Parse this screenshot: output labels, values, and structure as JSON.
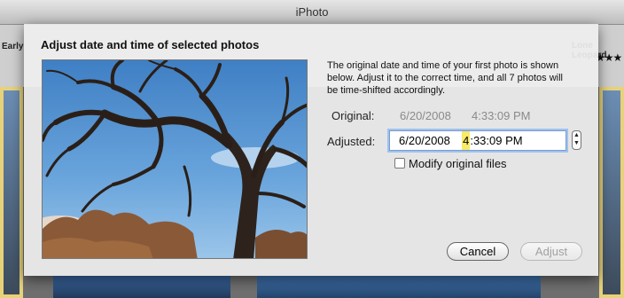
{
  "window": {
    "title": "iPhoto",
    "bg_labels": [
      "Early",
      "Lone Leopard"
    ],
    "bg_stars": "★★★"
  },
  "dialog": {
    "title": "Adjust date and time of selected photos",
    "description": "The original date and time of your first photo is shown below. Adjust it to the correct time, and all 7 photos will be time-shifted accordingly.",
    "original_label": "Original:",
    "original_date": "6/20/2008",
    "original_time": "4:33:09 PM",
    "adjusted_label": "Adjusted:",
    "adjusted_date": "6/20/2008",
    "adjusted_hour": "4",
    "adjusted_rest": ":33:09 PM",
    "modify_label": "Modify original files",
    "modify_checked": false,
    "cancel_label": "Cancel",
    "adjust_label": "Adjust"
  },
  "icons": {
    "stepper": "up-down-stepper-icon",
    "checkbox": "checkbox-icon"
  },
  "colors": {
    "field_focus": "#9ec2ee",
    "highlight": "#f8ea6a",
    "sky": "#5c93cf"
  }
}
